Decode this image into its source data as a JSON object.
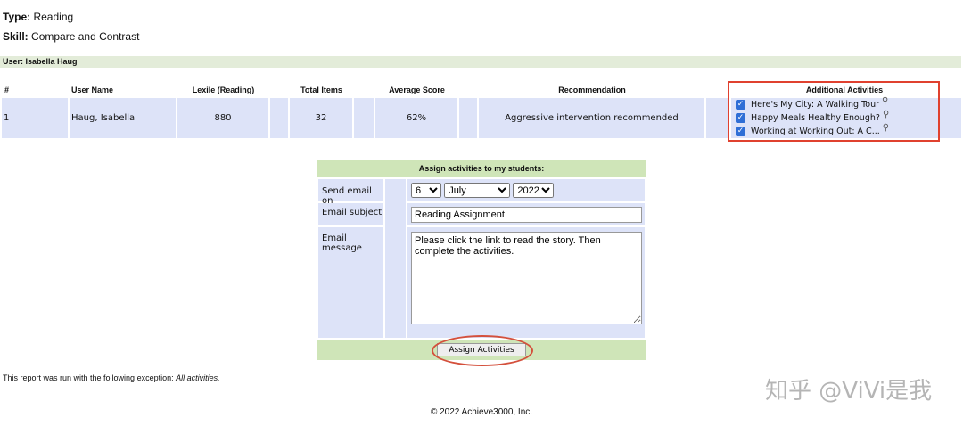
{
  "type": {
    "label": "Type:",
    "value": "Reading"
  },
  "skill": {
    "label": "Skill:",
    "value": "Compare and Contrast"
  },
  "user_bar": "User: Isabella Haug",
  "table": {
    "headers": [
      "#",
      "User Name",
      "Lexile (Reading)",
      "Total Items",
      "Average Score",
      "Recommendation",
      "Additional Activities"
    ],
    "row": {
      "num": "1",
      "name": "Haug, Isabella",
      "lexile": "880",
      "total": "32",
      "avg": "62%",
      "recommendation": "Aggressive intervention recommended",
      "activities": [
        "Here's My City: A Walking Tour",
        "Happy Meals Healthy Enough?",
        "Working at Working Out: A C..."
      ]
    }
  },
  "form": {
    "title": "Assign activities to my students:",
    "send_label": "Send email on",
    "day": "6",
    "month": "July",
    "year": "2022",
    "subject_label": "Email subject",
    "subject": "Reading Assignment",
    "message_label": "Email message",
    "message": "Please click the link to read the story. Then complete the activities.",
    "button": "Assign Activities"
  },
  "exception": {
    "text": "This report was run with the following exception: ",
    "value": "All activities."
  },
  "footer": "© 2022 Achieve3000, Inc.",
  "watermark": "知乎 @ViVi是我",
  "colors": {
    "highlight": "#e0412f",
    "green": "#cfe5b8",
    "blue": "#dde3f8"
  }
}
